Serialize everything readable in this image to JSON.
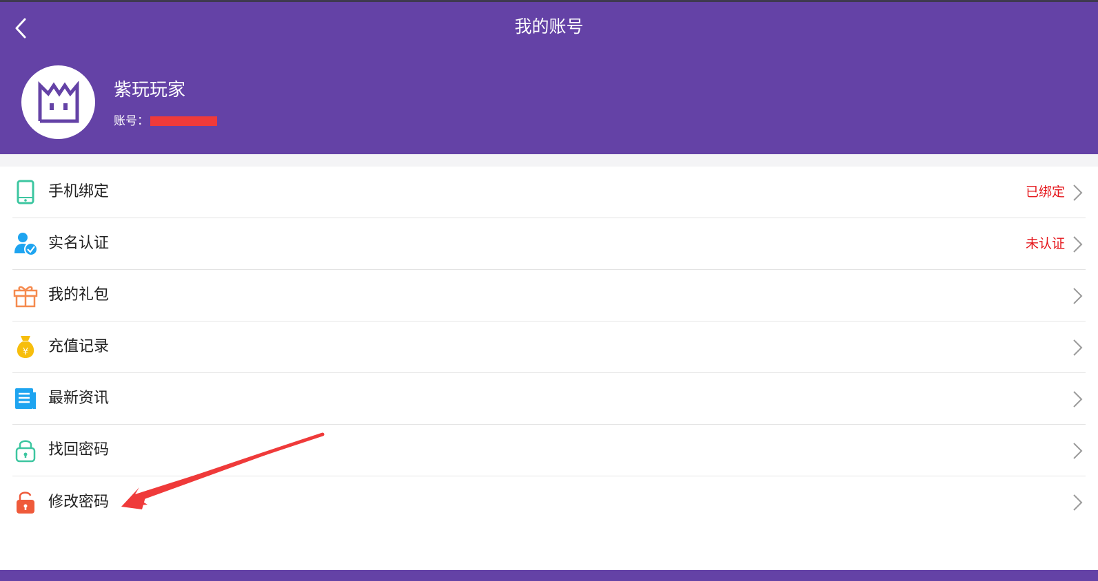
{
  "header": {
    "title": "我的账号",
    "back_icon": "chevron-left-icon",
    "background": "#6442a6"
  },
  "profile": {
    "name": "紫玩玩家",
    "account_label": "账号：",
    "avatar_icon": "crown-face-icon"
  },
  "menu": {
    "items": [
      {
        "label": "手机绑定",
        "status": "已绑定",
        "icon": "phone-icon",
        "icon_color": "#3cc6a0"
      },
      {
        "label": "实名认证",
        "status": "未认证",
        "icon": "user-verified-icon",
        "icon_color": "#1ea4f0"
      },
      {
        "label": "我的礼包",
        "status": "",
        "icon": "gift-icon",
        "icon_color": "#f58a4e"
      },
      {
        "label": "充值记录",
        "status": "",
        "icon": "money-bag-icon",
        "icon_color": "#f7be0d"
      },
      {
        "label": "最新资讯",
        "status": "",
        "icon": "news-icon",
        "icon_color": "#1ea4f0"
      },
      {
        "label": "找回密码",
        "status": "",
        "icon": "lock-icon",
        "icon_color": "#3cc6a0"
      },
      {
        "label": "修改密码",
        "status": "",
        "icon": "unlock-icon",
        "icon_color": "#ef5a3a"
      }
    ]
  },
  "colors": {
    "status_red": "#e5161b",
    "annotation_arrow": "#ef3a3a"
  }
}
